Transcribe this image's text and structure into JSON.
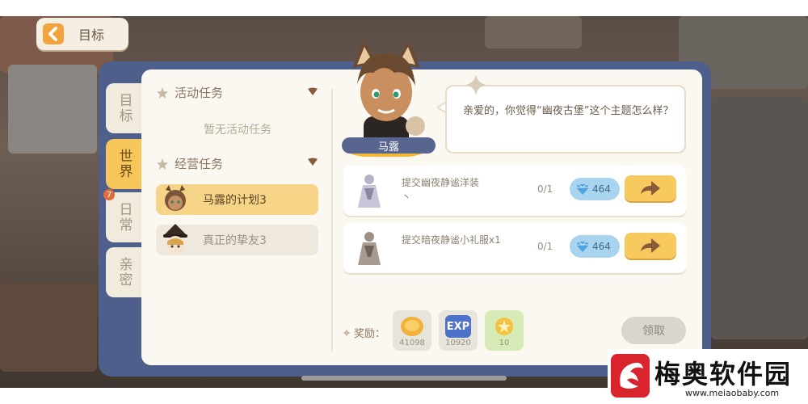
{
  "header": {
    "back_label": "目标"
  },
  "side_tabs": [
    {
      "label": "目标",
      "active": false
    },
    {
      "label": "世界",
      "active": true
    },
    {
      "label": "日常",
      "active": false,
      "badge": "7"
    },
    {
      "label": "亲密",
      "active": false
    }
  ],
  "task_list": {
    "activity_section": "活动任务",
    "activity_empty": "暂无活动任务",
    "business_section": "经营任务",
    "tasks": [
      {
        "name": "马露的计划3",
        "selected": true
      },
      {
        "name": "真正的挚友3",
        "selected": false
      }
    ]
  },
  "npc": {
    "name": "马露",
    "dialogue": "亲爱的，你觉得“幽夜古堡”这个主题怎么样？"
  },
  "quests": [
    {
      "desc": "提交幽夜静谧洋装\n丶",
      "progress": "0/1",
      "gem": "464"
    },
    {
      "desc": "提交暗夜静谧小礼服x1",
      "progress": "0/1",
      "gem": "464"
    }
  ],
  "rewards": {
    "label": "奖励：",
    "items": [
      {
        "icon": "gold-coin-icon",
        "value": "41098"
      },
      {
        "icon": "exp-icon",
        "icon_text": "EXP",
        "value": "10920"
      },
      {
        "icon": "star-token-icon",
        "value": "10"
      }
    ],
    "claim_label": "领取"
  },
  "watermark": {
    "name": "梅奥软件园",
    "url": "www.meiaobaby.com"
  },
  "colors": {
    "accent": "#f7c95f",
    "frame": "#4f5f8c",
    "panel": "#fbf8f1",
    "gem": "#a9d4ef"
  }
}
